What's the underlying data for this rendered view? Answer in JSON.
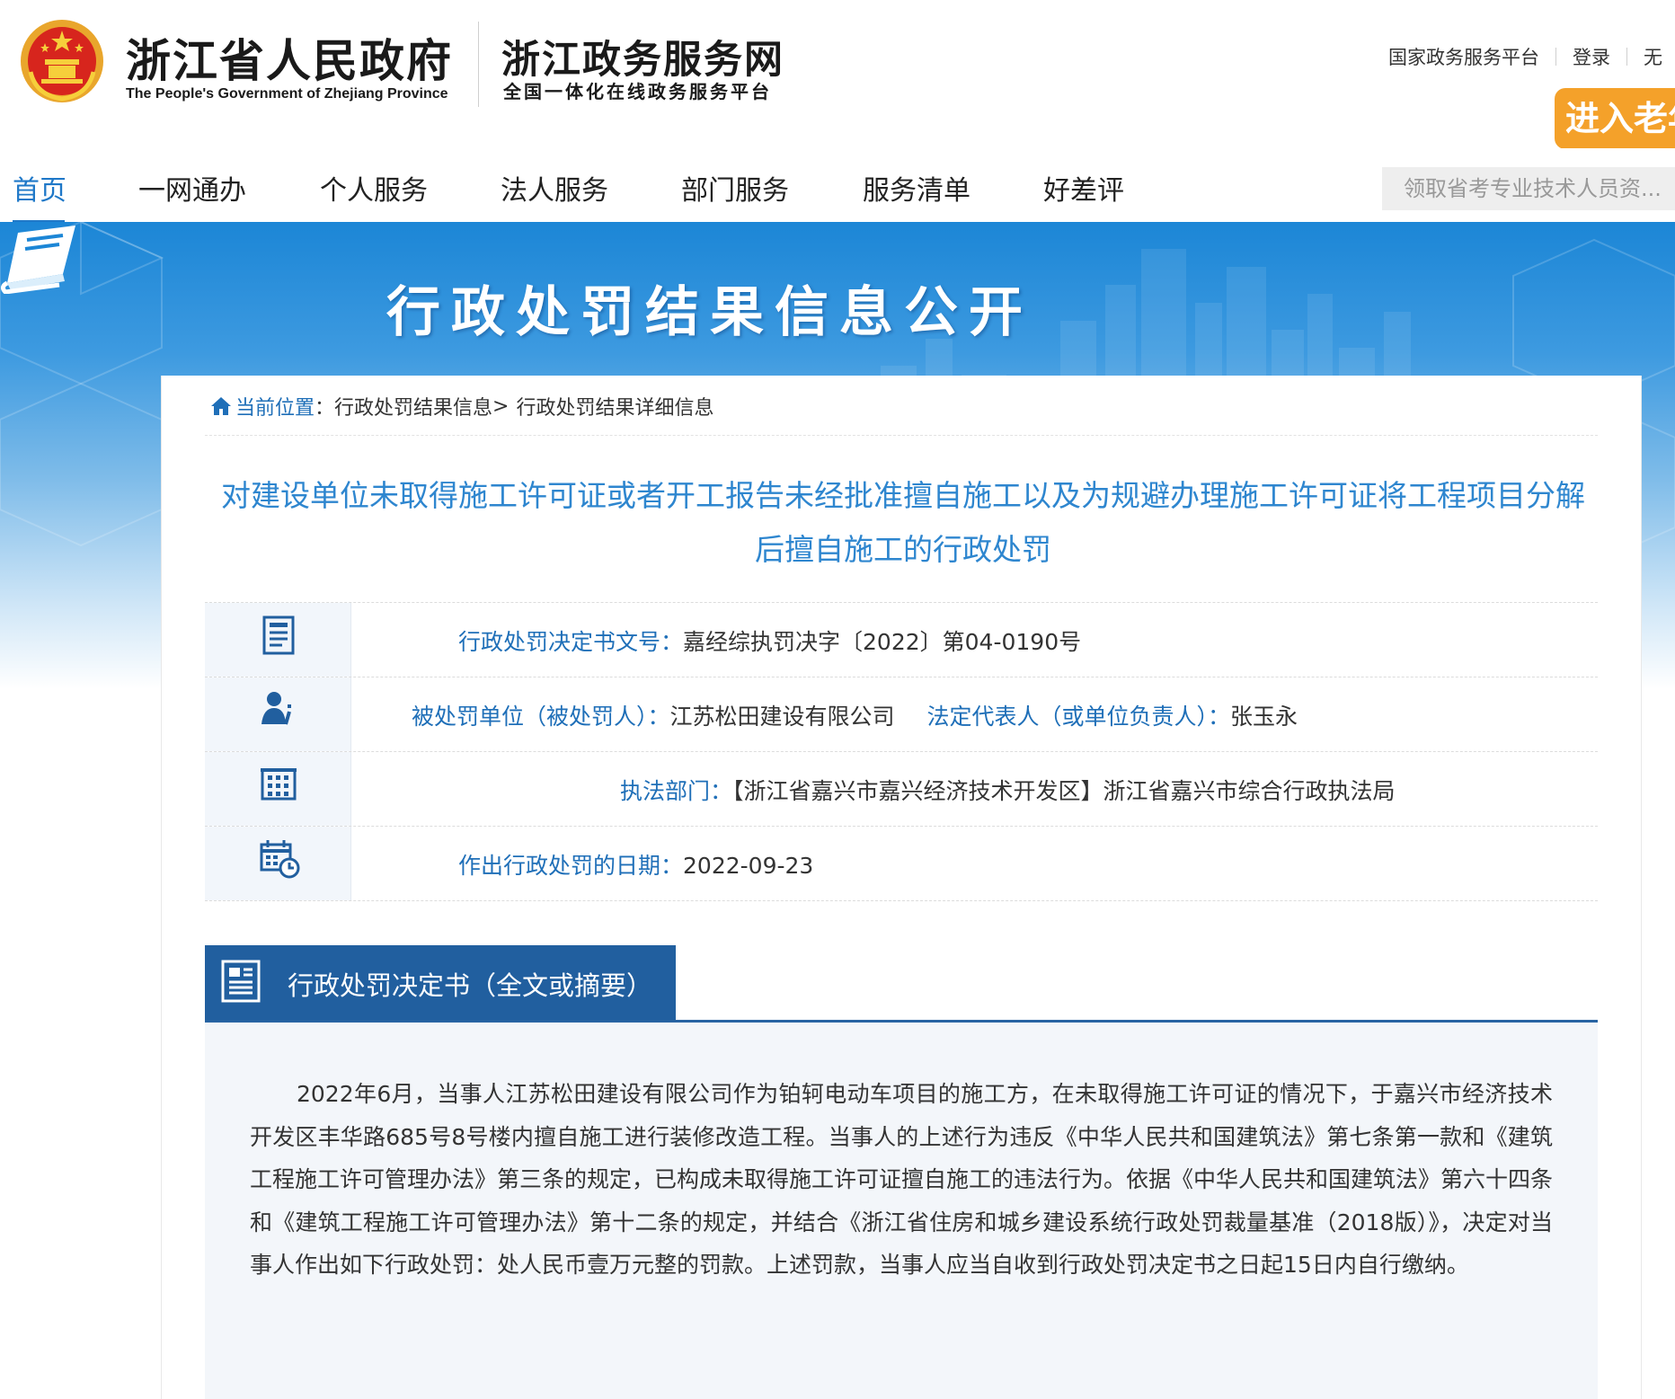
{
  "header": {
    "brand_cn": "浙江省人民政府",
    "brand_en": "The People's Government of Zhejiang Province",
    "site_cn": "浙江政务服务网",
    "site_sub": "全国一体化在线政务服务平台",
    "top_links": [
      "国家政务服务平台",
      "登录",
      "无"
    ],
    "elder_button": "进入老年"
  },
  "nav": {
    "items": [
      "首页",
      "一网通办",
      "个人服务",
      "法人服务",
      "部门服务",
      "服务清单",
      "好差评"
    ],
    "active_index": 0,
    "search_placeholder": "领取省考专业技术人员资..."
  },
  "banner": {
    "title": "行政处罚结果信息公开"
  },
  "breadcrumb": {
    "here": "当前位置",
    "sep": "：",
    "level1": "行政处罚结果信息",
    "arrow": ">",
    "level2": "行政处罚结果详细信息"
  },
  "document": {
    "title": "对建设单位未取得施工许可证或者开工报告未经批准擅自施工以及为规避办理施工许可证将工程项目分解后擅自施工的行政处罚"
  },
  "info": {
    "decision_no_label": "行政处罚决定书文号：",
    "decision_no": "嘉经综执罚决字〔2022〕第04-0190号",
    "party_label": "被处罚单位（被处罚人）：",
    "party": "江苏松田建设有限公司",
    "rep_label": "法定代表人（或单位负责人）：",
    "rep": "张玉永",
    "dept_label": "执法部门：",
    "dept": "【浙江省嘉兴市嘉兴经济技术开发区】浙江省嘉兴市综合行政执法局",
    "date_label": "作出行政处罚的日期：",
    "date": "2022-09-23"
  },
  "section": {
    "title": "行政处罚决定书（全文或摘要）",
    "body": "2022年6月，当事人江苏松田建设有限公司作为铂轲电动车项目的施工方，在未取得施工许可证的情况下，于嘉兴市经济技术开发区丰华路685号8号楼内擅自施工进行装修改造工程。当事人的上述行为违反《中华人民共和国建筑法》第七条第一款和《建筑工程施工许可管理办法》第三条的规定，已构成未取得施工许可证擅自施工的违法行为。依据《中华人民共和国建筑法》第六十四条和《建筑工程施工许可管理办法》第十二条的规定，并结合《浙江省住房和城乡建设系统行政处罚裁量基准（2018版）》，决定对当事人作出如下行政处罚：处人民币壹万元整的罚款。上述罚款，当事人应当自收到行政处罚决定书之日起15日内自行缴纳。"
  },
  "colors": {
    "accent": "#1f78c8",
    "link": "#1f6fb8",
    "title": "#2e86cf",
    "section": "#215f9f",
    "elder": "#f4a12a"
  }
}
